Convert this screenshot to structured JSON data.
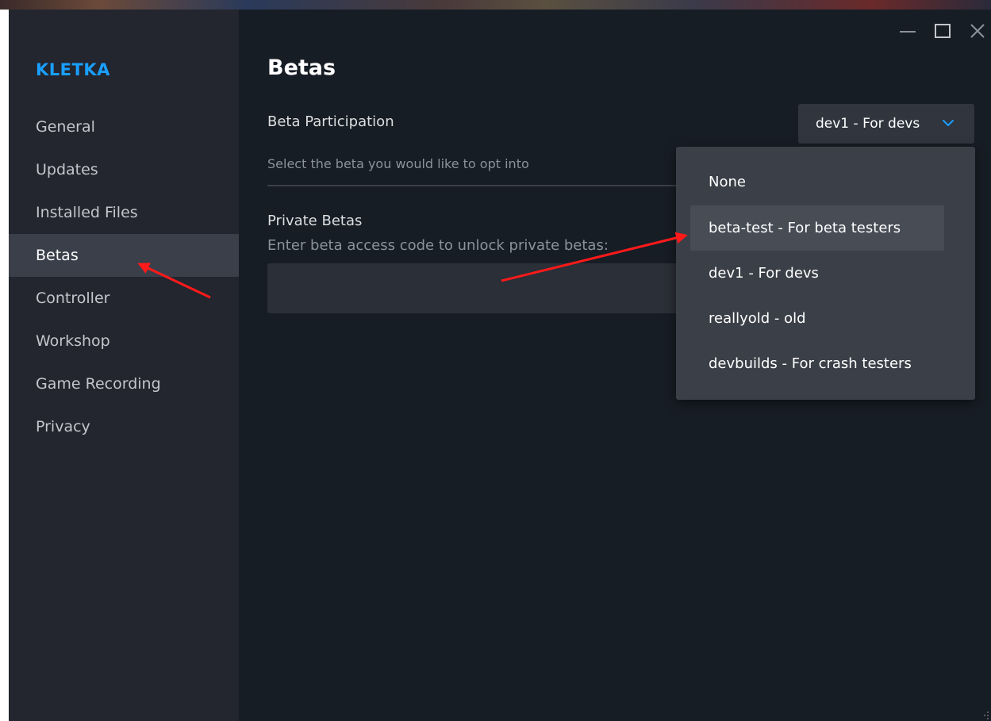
{
  "app": {
    "title": "KLETKA"
  },
  "sidebar": {
    "items": [
      {
        "label": "General"
      },
      {
        "label": "Updates"
      },
      {
        "label": "Installed Files"
      },
      {
        "label": "Betas"
      },
      {
        "label": "Controller"
      },
      {
        "label": "Workshop"
      },
      {
        "label": "Game Recording"
      },
      {
        "label": "Privacy"
      }
    ],
    "active": "Betas"
  },
  "main": {
    "title": "Betas",
    "beta_participation": {
      "label": "Beta Participation",
      "selected": "dev1 - For devs",
      "description": "Select the beta you would like to opt into",
      "options": [
        {
          "label": "None"
        },
        {
          "label": "beta-test - For beta testers"
        },
        {
          "label": "dev1 - For devs"
        },
        {
          "label": "reallyold - old"
        },
        {
          "label": "devbuilds - For crash testers"
        }
      ],
      "hovered_option": "beta-test - For beta testers"
    },
    "private_betas": {
      "label": "Private Betas",
      "hint": "Enter beta access code to unlock private betas:",
      "input_value": "",
      "input_placeholder": ""
    }
  },
  "window_controls": [
    "minimize-icon",
    "maximize-icon",
    "close-icon"
  ],
  "colors": {
    "accent": "#1a9fff",
    "sidebar_bg": "#23262e",
    "content_bg": "#171d25",
    "dropdown_bg": "#3b3f47",
    "annotation_arrow": "#ff1a1a"
  }
}
